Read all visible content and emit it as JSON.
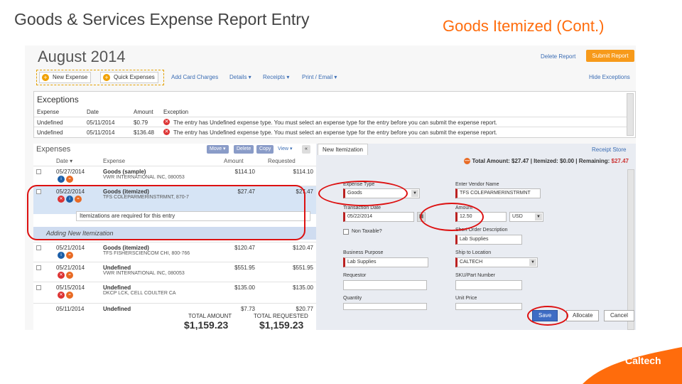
{
  "slide": {
    "left_title": "Goods & Services Expense Report Entry",
    "right_title": "Goods Itemized (Cont.)",
    "logo": "Caltech"
  },
  "report": {
    "month": "August 2014",
    "delete_report": "Delete Report",
    "submit_report": "Submit Report",
    "hide_exceptions": "Hide Exceptions",
    "receipt_store": "Receipt Store"
  },
  "toolbar": {
    "new_expense": "New Expense",
    "quick_expenses": "Quick Expenses",
    "add_card_charges": "Add Card Charges",
    "details": "Details ▾",
    "receipts": "Receipts ▾",
    "print_email": "Print / Email ▾"
  },
  "exceptions": {
    "title": "Exceptions",
    "columns": [
      "Expense",
      "Date",
      "Amount",
      "Exception"
    ],
    "rows": [
      {
        "expense": "Undefined",
        "date": "05/11/2014",
        "amount": "$0.79",
        "message": "The entry has Undefined expense type. You must select an expense type for the entry before you can submit the expense report."
      },
      {
        "expense": "Undefined",
        "date": "05/11/2014",
        "amount": "$136.48",
        "message": "The entry has Undefined expense type. You must select an expense type for the entry before you can submit the expense report."
      }
    ]
  },
  "expenses": {
    "title": "Expenses",
    "buttons": {
      "move": "Move ▾",
      "delete": "Delete",
      "copy": "Copy",
      "view": "View ▾",
      "collapse": "«"
    },
    "columns": {
      "date": "Date ▾",
      "expense": "Expense",
      "amount": "Amount",
      "requested": "Requested"
    },
    "rows": [
      {
        "date": "05/27/2014",
        "name": "Goods (sample)",
        "sub": "VWR INTERNATIONAL INC, 080053",
        "amount": "$114.10",
        "requested": "$114.10"
      },
      {
        "date": "05/22/2014",
        "name": "Goods (itemized)",
        "sub": "TFS COLEPARMERINSTRMNT, 870-7",
        "amount": "$27.47",
        "requested": "$27.47"
      },
      {
        "date": "05/21/2014",
        "name": "Goods (itemized)",
        "sub": "TFS FISHERSCIENCOM CHI, 800-766",
        "amount": "$120.47",
        "requested": "$120.47"
      },
      {
        "date": "05/21/2014",
        "name": "Undefined",
        "sub": "VWR INTERNATIONAL INC, 080053",
        "amount": "$551.95",
        "requested": "$551.95"
      },
      {
        "date": "05/15/2014",
        "name": "Undefined",
        "sub": "DKCP LCK, CELL COULTER CA",
        "amount": "$135.00",
        "requested": "$135.00"
      },
      {
        "date": "05/11/2014",
        "name": "Undefined",
        "sub": "",
        "amount": "$7.73",
        "requested": "$20.77"
      }
    ],
    "itemization_note": "Itemizations are required for this entry",
    "add_itemization": "Adding New Itemization",
    "total_amount_label": "TOTAL AMOUNT",
    "total_requested_label": "TOTAL REQUESTED",
    "total_amount": "$1,159.23",
    "total_requested": "$1,159.23"
  },
  "form": {
    "tab": "New Itemization",
    "total_line": "Total Amount: $27.47 | Itemized: $0.00 | Remaining: ",
    "remaining": "$27.47",
    "fields": {
      "expense_type": {
        "label": "Expense Type",
        "value": "Goods"
      },
      "vendor": {
        "label": "Enter Vendor Name",
        "value": "TFS COLEPARMERINSTRMNT"
      },
      "transaction_date": {
        "label": "Transaction Date",
        "value": "05/22/2014"
      },
      "amount": {
        "label": "Amount",
        "value": "12.50",
        "currency": "USD"
      },
      "non_taxable": {
        "label": "Non Taxable?"
      },
      "short_desc": {
        "label": "Short Order Description",
        "value": "Lab Supplies"
      },
      "business_purpose": {
        "label": "Business Purpose",
        "value": "Lab Supplies"
      },
      "ship_to": {
        "label": "Ship to Location",
        "value": "CALTECH"
      },
      "requestor": {
        "label": "Requestor",
        "value": ""
      },
      "sku": {
        "label": "SKU/Part Number",
        "value": ""
      },
      "quantity": {
        "label": "Quantity",
        "value": ""
      },
      "unit_price": {
        "label": "Unit Price",
        "value": ""
      }
    },
    "buttons": {
      "save": "Save",
      "allocate": "Allocate",
      "cancel": "Cancel"
    }
  },
  "colors": {
    "title_orange": "#ff6c0c",
    "annotation_red": "#dd1111",
    "submit_orange": "#f79a1a",
    "link_blue": "#3b6db4",
    "logo_orange": "#ff6c0c"
  }
}
